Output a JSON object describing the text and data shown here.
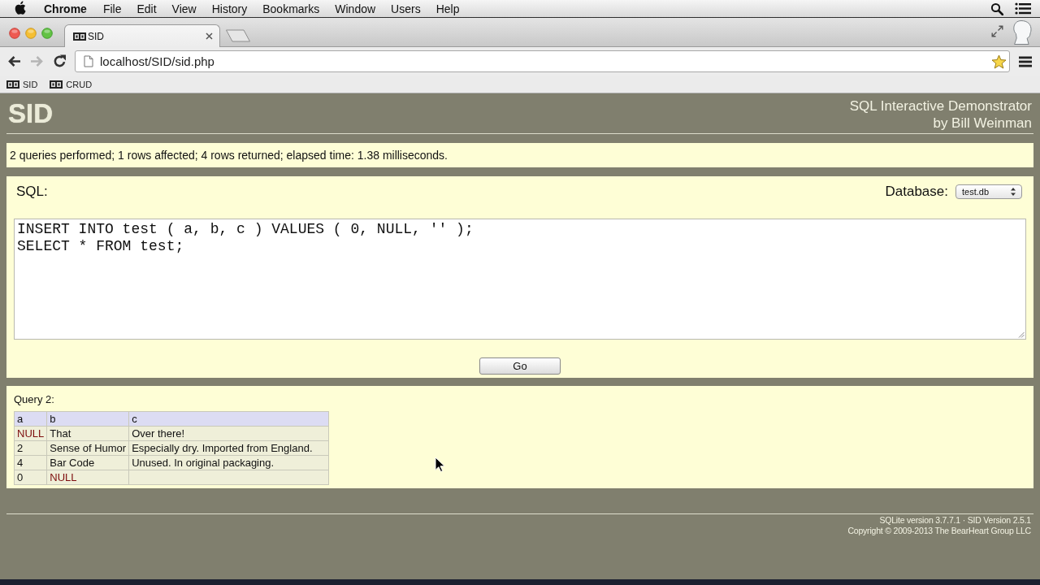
{
  "menu_bar": {
    "app_name": "Chrome",
    "items": [
      "File",
      "Edit",
      "View",
      "History",
      "Bookmarks",
      "Window",
      "Users",
      "Help"
    ]
  },
  "tabs": [
    {
      "label": "SID",
      "selected": true
    }
  ],
  "toolbar": {
    "back_enabled": true,
    "forward_enabled": false,
    "url": "localhost/SID/sid.php"
  },
  "bookmarks": [
    {
      "label": "SID"
    },
    {
      "label": "CRUD"
    }
  ],
  "page": {
    "logo": "SID",
    "title_lines": [
      "SQL Interactive Demonstrator",
      "by Bill Weinman"
    ],
    "message": "2 queries performed; 1 rows affected; 4 rows returned; elapsed time: 1.38 milliseconds.",
    "sql_form": {
      "label": "SQL:",
      "database_label": "Database:",
      "database": "test.db",
      "query": "INSERT INTO test ( a, b, c ) VALUES ( 0, NULL, '' );\nSELECT * FROM test;",
      "submit": "Go"
    },
    "results": [
      {
        "title": "Query 2:",
        "columns": [
          "a",
          "b",
          "c"
        ],
        "rows": [
          [
            {
              "kind": "null",
              "text": "NULL"
            },
            {
              "kind": "value",
              "text": "That"
            },
            {
              "kind": "value",
              "text": "Over there!"
            }
          ],
          [
            {
              "kind": "value",
              "text": "2"
            },
            {
              "kind": "value",
              "text": "Sense of Humor"
            },
            {
              "kind": "value",
              "text": "Especially dry. Imported from England."
            }
          ],
          [
            {
              "kind": "value",
              "text": "4"
            },
            {
              "kind": "value",
              "text": "Bar Code"
            },
            {
              "kind": "value",
              "text": "Unused. In original packaging."
            }
          ],
          [
            {
              "kind": "value",
              "text": "0"
            },
            {
              "kind": "null",
              "text": "NULL"
            },
            {
              "kind": "empty"
            }
          ]
        ]
      }
    ],
    "footer": [
      "SQLite version 3.7.7.1 · SID Version 2.5.1",
      "Copyright © 2009-2013 The BearHeart Group LLC"
    ]
  }
}
